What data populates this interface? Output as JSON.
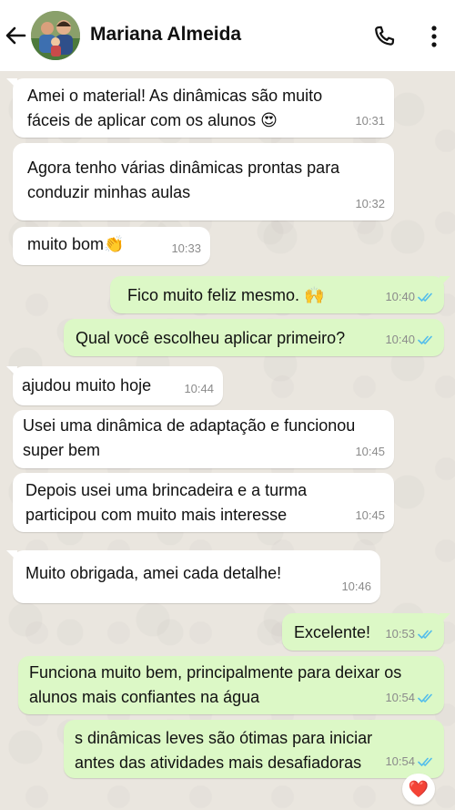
{
  "header": {
    "contact_name": "Mariana Almeida",
    "icons": [
      "back-arrow-icon",
      "avatar",
      "phone-icon",
      "more-vertical-icon"
    ]
  },
  "messages": [
    {
      "side": "in",
      "text": "Amei o material! As dinâmicas são muito\nfáceis de aplicar com os alunos 😍",
      "time": "10:31"
    },
    {
      "side": "in",
      "text": "Agora tenho várias dinâmicas prontas para\nconduzir minhas aulas",
      "time": "10:32"
    },
    {
      "side": "in",
      "text": "muito bom👏",
      "time": "10:33"
    },
    {
      "side": "out",
      "text": "Fico muito feliz mesmo. 🙌",
      "time": "10:40",
      "status": "read"
    },
    {
      "side": "out",
      "text": "Qual você escolheu aplicar primeiro?",
      "time": "10:40",
      "status": "read"
    },
    {
      "side": "in",
      "text": "ajudou muito hoje",
      "time": "10:44"
    },
    {
      "side": "in",
      "text": "Usei uma dinâmica de adaptação e funcionou\nsuper bem",
      "time": "10:45"
    },
    {
      "side": "in",
      "text": "Depois usei uma brincadeira e a turma\nparticipou com muito mais interesse",
      "time": "10:45"
    },
    {
      "side": "in",
      "text": "Muito obrigada, amei cada detalhe!",
      "time": "10:46"
    },
    {
      "side": "out",
      "text": "Excelente!",
      "time": "10:53",
      "status": "read"
    },
    {
      "side": "out",
      "text": "Funciona muito bem, principalmente para deixar os\nalunos mais confiantes na água",
      "time": "10:54",
      "status": "read"
    },
    {
      "side": "out",
      "text": "s dinâmicas leves são ótimas para iniciar\nantes das atividades mais desafiadoras",
      "time": "10:54",
      "status": "read"
    }
  ],
  "reaction": {
    "emoji": "❤️"
  },
  "colors": {
    "incoming_bubble": "#ffffff",
    "outgoing_bubble": "#dcf8c6",
    "read_ticks": "#53bdeb",
    "wallpaper": "#eae6df"
  }
}
